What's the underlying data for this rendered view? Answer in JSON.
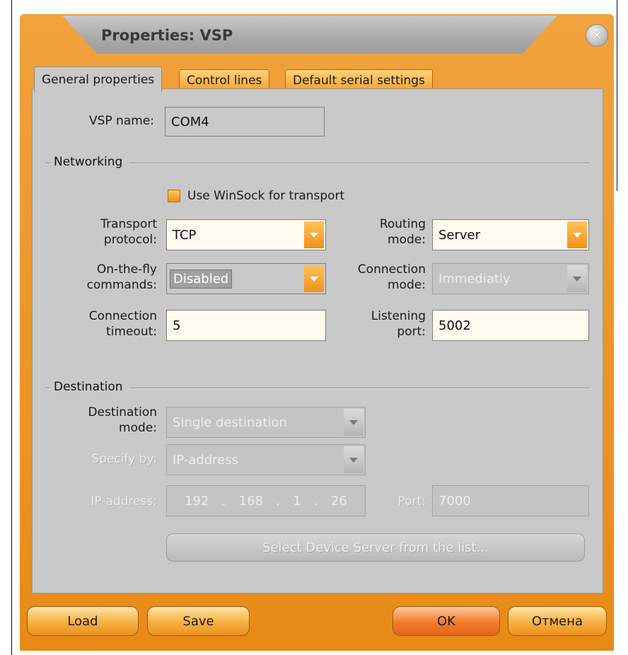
{
  "window": {
    "title": "Properties: VSP",
    "close_icon": "close-icon"
  },
  "tabs": [
    {
      "label": "General properties",
      "active": true
    },
    {
      "label": "Control lines",
      "active": false
    },
    {
      "label": "Default serial settings",
      "active": false
    }
  ],
  "vsp": {
    "label": "VSP name:",
    "value": "COM4"
  },
  "networking": {
    "group_label": "Networking",
    "use_winsock_label": "Use WinSock for transport",
    "transport_protocol": {
      "label_1": "Transport",
      "label_2": "protocol:",
      "value": "TCP"
    },
    "routing_mode": {
      "label_1": "Routing",
      "label_2": "mode:",
      "value": "Server"
    },
    "on_the_fly": {
      "label_1": "On-the-fly",
      "label_2": "commands:",
      "value": "Disabled"
    },
    "connection_mode": {
      "label_1": "Connection",
      "label_2": "mode:",
      "value": "Immediatly"
    },
    "connection_timeout": {
      "label_1": "Connection",
      "label_2": "timeout:",
      "value": "5"
    },
    "listening_port": {
      "label_1": "Listening",
      "label_2": "port:",
      "value": "5002"
    }
  },
  "destination": {
    "group_label": "Destination",
    "destination_mode": {
      "label_1": "Destination",
      "label_2": "mode:",
      "value": "Single destination"
    },
    "specify_by": {
      "label": "Specify by:",
      "value": "IP-address"
    },
    "ip_address": {
      "label": "IP-address:",
      "octets": [
        "192",
        "168",
        "1",
        "26"
      ],
      "separator": "."
    },
    "port": {
      "label": "Port:",
      "value": "7000"
    },
    "select_server_label": "Select Device Server from the list..."
  },
  "buttons": {
    "load": "Load",
    "save": "Save",
    "ok": "OK",
    "cancel": "Отмена"
  },
  "colors": {
    "accent": "#f0961e",
    "panel": "#c9c9c9"
  }
}
